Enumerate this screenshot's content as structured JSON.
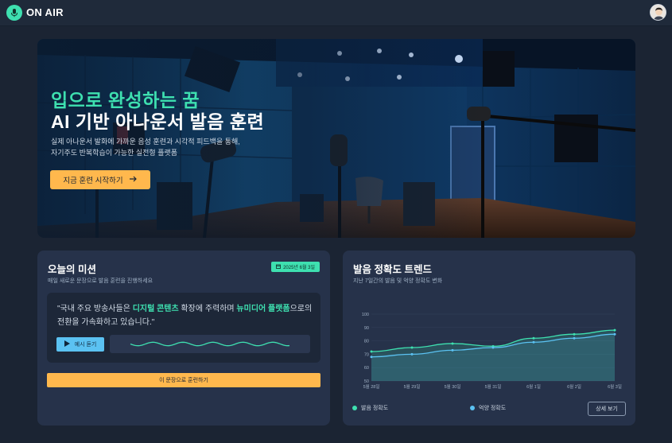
{
  "header": {
    "logo_text": "ON AIR",
    "logo_icon": "microphone-icon",
    "avatar_icon": "user-avatar"
  },
  "hero": {
    "title_line1": "입으로 완성하는 꿈",
    "title_line2": "AI 기반 아나운서 발음 훈련",
    "subtitle_line1": "실제 아나운서 발화에 가까운 음성 훈련과 시각적 피드백을 통해,",
    "subtitle_line2": "자기주도 반복학습이 가능한 실전형 플랫폼",
    "cta_label": "지금 훈련 시작하기",
    "cta_icon": "arrow-right-icon"
  },
  "mission": {
    "title": "오늘의 미션",
    "subtitle": "매일 새로운 문장으로 발음 훈련을 진행하세요",
    "date": "2025년 6월 3일",
    "date_icon": "calendar-icon",
    "quote_pre": "\"국내 주요 방송사들은 ",
    "quote_hl1": "디지털 콘텐츠",
    "quote_mid": " 확장에 주력하며 ",
    "quote_hl2": "뉴미디어 플랫폼",
    "quote_post": "으로의 전환을 가속화하고 있습니다.\"",
    "play_label": "예시 듣기",
    "play_icon": "play-icon",
    "train_label": "이 문장으로 훈련하기",
    "accent": "#3ee0b0",
    "button_color": "#ffb84d"
  },
  "trend": {
    "title": "발음 정확도 트렌드",
    "subtitle": "지난 7일간의 발음 및 억양 정확도 변화",
    "detail_label": "상세 보기"
  },
  "chart_data": {
    "type": "line",
    "x": [
      "5월 28일",
      "5월 29일",
      "5월 30일",
      "5월 31일",
      "6월 1일",
      "6월 2일",
      "6월 3일"
    ],
    "series": [
      {
        "name": "발음 정확도",
        "values": [
          72,
          75,
          78,
          76,
          82,
          85,
          88
        ],
        "color": "#3ee0b0"
      },
      {
        "name": "억양 정확도",
        "values": [
          68,
          70,
          73,
          75,
          79,
          82,
          85
        ],
        "color": "#5bc2f2"
      }
    ],
    "yticks": [
      50,
      60,
      70,
      80,
      90,
      100
    ],
    "ylim": [
      50,
      100
    ],
    "legend_position": "bottom"
  }
}
